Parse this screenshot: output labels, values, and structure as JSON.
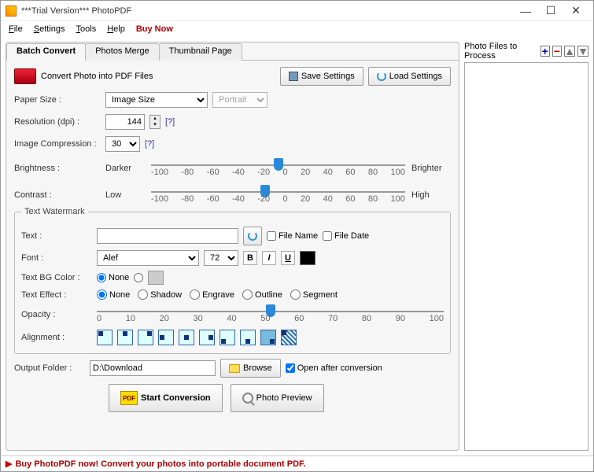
{
  "window": {
    "title": "***Trial Version*** PhotoPDF"
  },
  "menu": {
    "file": "File",
    "settings": "Settings",
    "tools": "Tools",
    "help": "Help",
    "buy": "Buy Now"
  },
  "tabs": {
    "batch": "Batch Convert",
    "merge": "Photos Merge",
    "thumb": "Thumbnail Page"
  },
  "head": {
    "title": "Convert Photo into PDF Files",
    "save": "Save Settings",
    "load": "Load Settings"
  },
  "paper": {
    "label": "Paper Size :",
    "size": "Image Size",
    "orient": "Portrait"
  },
  "res": {
    "label": "Resolution (dpi) :",
    "value": "144",
    "help": "[?]"
  },
  "comp": {
    "label": "Image Compression :",
    "value": "30",
    "help": "[?]"
  },
  "bright": {
    "label": "Brightness :",
    "low": "Darker",
    "high": "Brighter"
  },
  "contrast": {
    "label": "Contrast :",
    "low": "Low",
    "high": "High"
  },
  "ticks": [
    "-100",
    "-80",
    "-60",
    "-40",
    "-20",
    "0",
    "20",
    "40",
    "60",
    "80",
    "100"
  ],
  "wm": {
    "legend": "Text Watermark",
    "text_label": "Text :",
    "filename": "File Name",
    "filedate": "File Date",
    "font_label": "Font :",
    "font": "Alef",
    "size": "72",
    "bg_label": "Text BG Color :",
    "none": "None",
    "effect_label": "Text Effect :",
    "effects": [
      "None",
      "Shadow",
      "Engrave",
      "Outline",
      "Segment"
    ],
    "opacity_label": "Opacity :",
    "op_ticks": [
      "0",
      "10",
      "20",
      "30",
      "40",
      "50",
      "60",
      "70",
      "80",
      "90",
      "100"
    ],
    "align_label": "Alignment :"
  },
  "out": {
    "label": "Output Folder :",
    "path": "D:\\Download",
    "browse": "Browse",
    "open": "Open after conversion"
  },
  "actions": {
    "start": "Start Conversion",
    "preview": "Photo Preview",
    "pdf": "PDF"
  },
  "right": {
    "label": "Photo Files to Process"
  },
  "footer": {
    "msg": "Buy PhotoPDF now! Convert your photos into portable document PDF."
  }
}
